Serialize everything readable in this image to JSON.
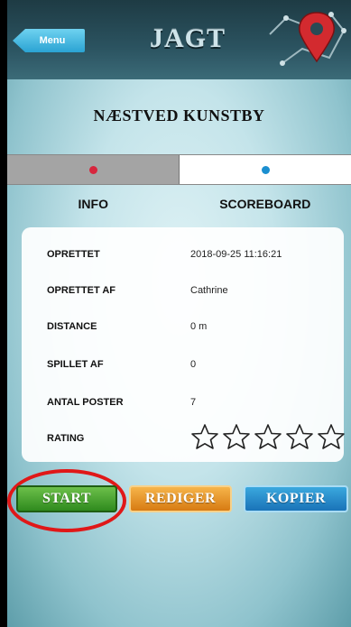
{
  "header": {
    "menu_label": "Menu",
    "title": "JAGT"
  },
  "subtitle": "NÆSTVED KUNSTBY",
  "tabs": [
    {
      "label": "INFO"
    },
    {
      "label": "SCOREBOARD"
    }
  ],
  "info": {
    "rows": [
      {
        "label": "OPRETTET",
        "value": "2018-09-25 11:16:21"
      },
      {
        "label": "OPRETTET AF",
        "value": "Cathrine"
      },
      {
        "label": "DISTANCE",
        "value": "0 m"
      },
      {
        "label": "SPILLET AF",
        "value": "0"
      },
      {
        "label": "ANTAL POSTER",
        "value": "7"
      }
    ],
    "rating_label": "RATING",
    "rating_value": 0,
    "rating_max": 5
  },
  "buttons": {
    "start": "START",
    "edit": "REDIGER",
    "copy": "KOPIER"
  },
  "colors": {
    "tab_dot_info": "#d7263d",
    "tab_dot_scoreboard": "#1b8fd0",
    "highlight": "#e01818"
  }
}
